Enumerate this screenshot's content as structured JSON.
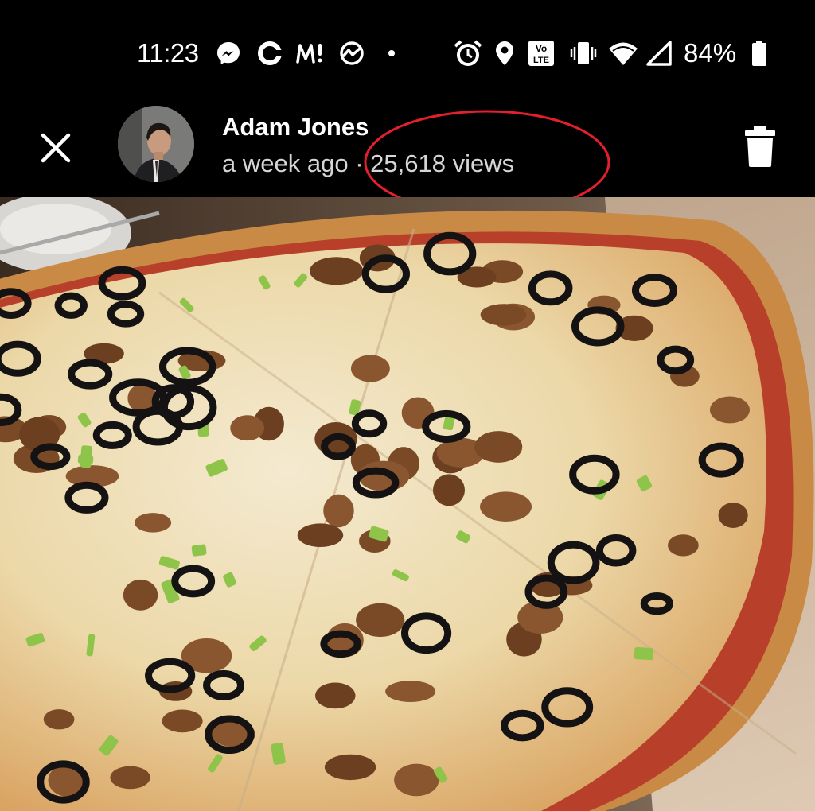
{
  "status_bar": {
    "time": "11:23",
    "battery_text": "84%",
    "notification_icons": [
      "messenger-icon",
      "sync-app-icon",
      "meetup-icon",
      "chart-app-icon",
      "dot-icon"
    ],
    "system_icons": [
      "alarm-icon",
      "location-icon",
      "volte-icon",
      "vibrate-icon",
      "wifi-icon",
      "cell-signal-icon",
      "battery-icon"
    ],
    "volte_label_top": "Vo",
    "volte_label_bottom": "LTE"
  },
  "viewer": {
    "owner_name": "Adam Jones",
    "posted": "a week ago",
    "separator": "·",
    "views": "25,618 views",
    "annotation_color": "#e3202b"
  }
}
